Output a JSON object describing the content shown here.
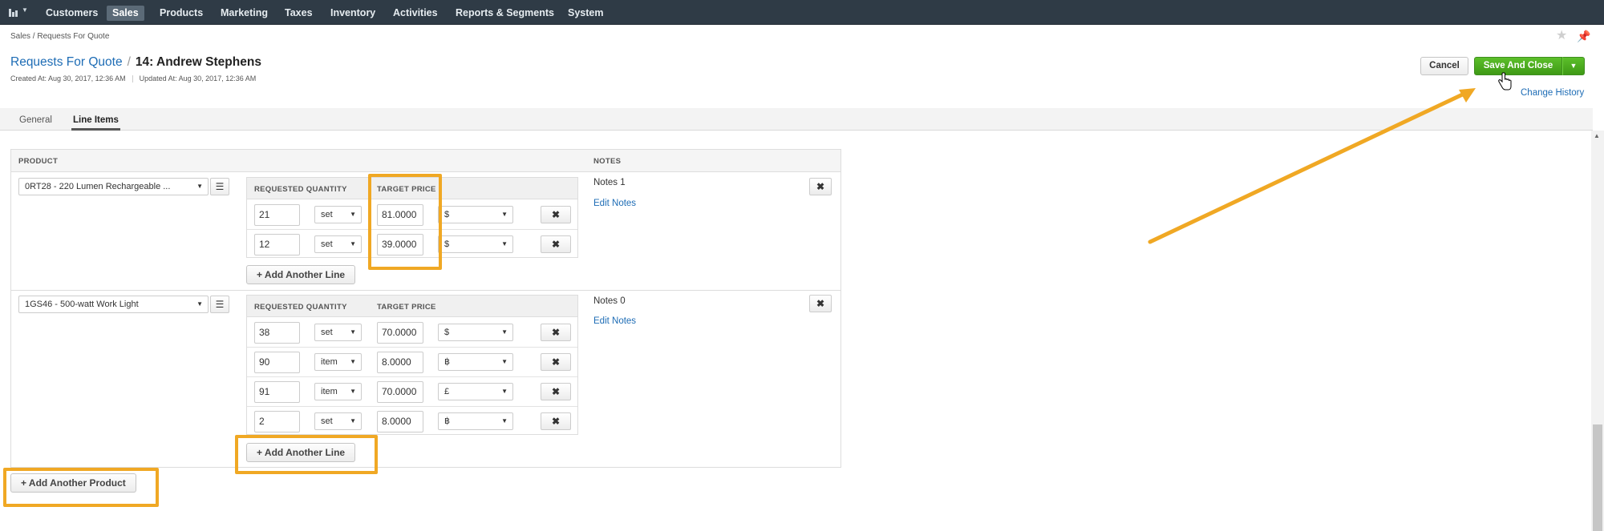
{
  "nav": {
    "logo_icon": "bar-chart-icon",
    "items": [
      "Customers",
      "Sales",
      "Products",
      "Marketing",
      "Taxes",
      "Inventory",
      "Activities",
      "Reports & Segments",
      "System"
    ],
    "active": "Sales"
  },
  "breadcrumb": "Sales / Requests For Quote",
  "header": {
    "parent_link": "Requests For Quote",
    "separator": "/",
    "title": "14: Andrew Stephens",
    "created": "Created At: Aug 30, 2017, 12:36 AM",
    "updated": "Updated At: Aug 30, 2017, 12:36 AM"
  },
  "actions": {
    "cancel": "Cancel",
    "save": "Save And Close",
    "change_history": "Change History"
  },
  "tabs": [
    "General",
    "Line Items"
  ],
  "active_tab": "Line Items",
  "columns": {
    "product": "PRODUCT",
    "notes": "NOTES",
    "requested_quantity": "REQUESTED QUANTITY",
    "target_price": "TARGET PRICE"
  },
  "products": [
    {
      "product": "0RT28 - 220 Lumen Rechargeable ...",
      "notes": "Notes 1",
      "edit_notes": "Edit Notes",
      "lines": [
        {
          "qty": "21",
          "unit": "set",
          "price": "81.0000",
          "currency": "$"
        },
        {
          "qty": "12",
          "unit": "set",
          "price": "39.0000",
          "currency": "$"
        }
      ]
    },
    {
      "product": "1GS46 - 500-watt Work Light",
      "notes": "Notes 0",
      "edit_notes": "Edit Notes",
      "lines": [
        {
          "qty": "38",
          "unit": "set",
          "price": "70.0000",
          "currency": "$"
        },
        {
          "qty": "90",
          "unit": "item",
          "price": "8.0000",
          "currency": "฿"
        },
        {
          "qty": "91",
          "unit": "item",
          "price": "70.0000",
          "currency": "£"
        },
        {
          "qty": "2",
          "unit": "set",
          "price": "8.0000",
          "currency": "฿"
        }
      ]
    }
  ],
  "add_line": "+ Add Another Line",
  "add_product": "+ Add Another Product",
  "colors": {
    "nav_bg": "#2f3b46",
    "link": "#1d6cb5",
    "save_green": "#4caf22",
    "highlight": "#f0a824"
  }
}
